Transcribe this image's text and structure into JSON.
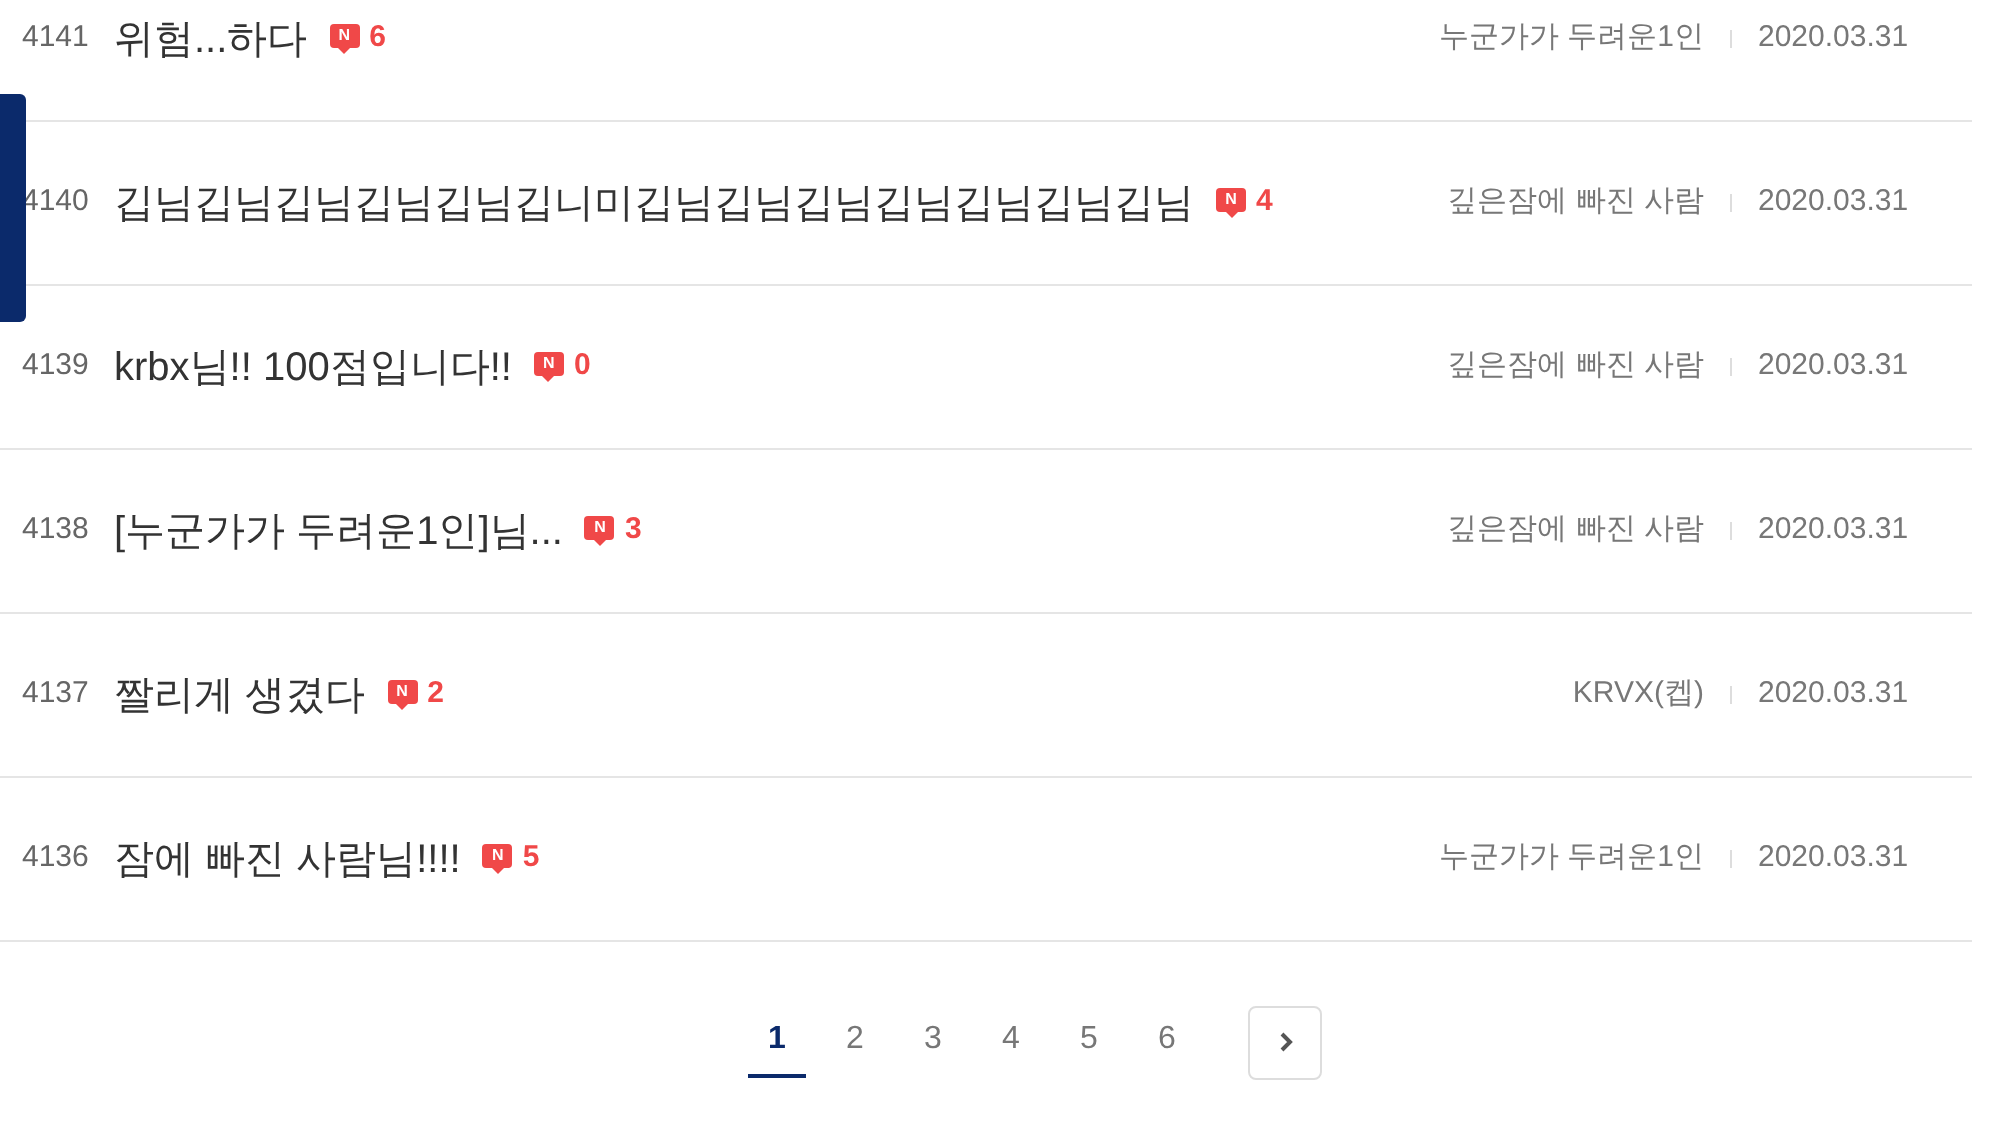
{
  "posts": [
    {
      "number": "4141",
      "title": "위험...하다",
      "badge": "N",
      "comments": "6",
      "author": "누군가가 두려운1인",
      "date": "2020.03.31"
    },
    {
      "number": "4140",
      "title": "깁님깁님깁님깁님깁님깁니미깁님깁님깁님깁님깁님깁님깁님",
      "badge": "N",
      "comments": "4",
      "author": "깊은잠에 빠진 사람",
      "date": "2020.03.31"
    },
    {
      "number": "4139",
      "title": "krbx님!! 100점입니다!!",
      "badge": "N",
      "comments": "0",
      "author": "깊은잠에 빠진 사람",
      "date": "2020.03.31"
    },
    {
      "number": "4138",
      "title": "[누군가가 두려운1인]님...",
      "badge": "N",
      "comments": "3",
      "author": "깊은잠에 빠진 사람",
      "date": "2020.03.31"
    },
    {
      "number": "4137",
      "title": "짤리게 생겼다",
      "badge": "N",
      "comments": "2",
      "author": "KRVX(켑)",
      "date": "2020.03.31"
    },
    {
      "number": "4136",
      "title": "잠에 빠진 사람님!!!!",
      "badge": "N",
      "comments": "5",
      "author": "누군가가 두려운1인",
      "date": "2020.03.31"
    }
  ],
  "pagination": {
    "pages": [
      {
        "label": "1",
        "selected": true
      },
      {
        "label": "2",
        "selected": false
      },
      {
        "label": "3",
        "selected": false
      },
      {
        "label": "4",
        "selected": false
      },
      {
        "label": "5",
        "selected": false
      },
      {
        "label": "6",
        "selected": false
      }
    ]
  }
}
